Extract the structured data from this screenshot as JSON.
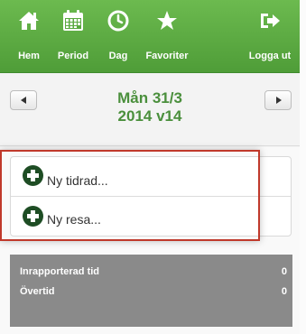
{
  "nav": {
    "items": [
      {
        "label": "Hem",
        "icon": "home-icon"
      },
      {
        "label": "Period",
        "icon": "calendar-icon"
      },
      {
        "label": "Dag",
        "icon": "clock-icon"
      },
      {
        "label": "Favoriter",
        "icon": "star-icon"
      }
    ],
    "logout": {
      "label": "Logga ut",
      "icon": "logout-icon"
    }
  },
  "date": {
    "line1": "Mån 31/3",
    "line2": "2014 v14",
    "color": "#4a8f3c"
  },
  "actions": [
    {
      "label": "Ny tidrad...",
      "icon": "plus-circle-icon"
    },
    {
      "label": "Ny resa...",
      "icon": "plus-circle-icon"
    }
  ],
  "summary": {
    "rows": [
      {
        "label": "Inrapporterad tid",
        "value": "0"
      },
      {
        "label": "Övertid",
        "value": "0"
      }
    ]
  },
  "colors": {
    "navbar": "#5aa940",
    "accent": "#4a8f3c",
    "icon_dark": "#1e4d24",
    "summary_bg": "#8a8a8a",
    "highlight": "#c0392b"
  }
}
